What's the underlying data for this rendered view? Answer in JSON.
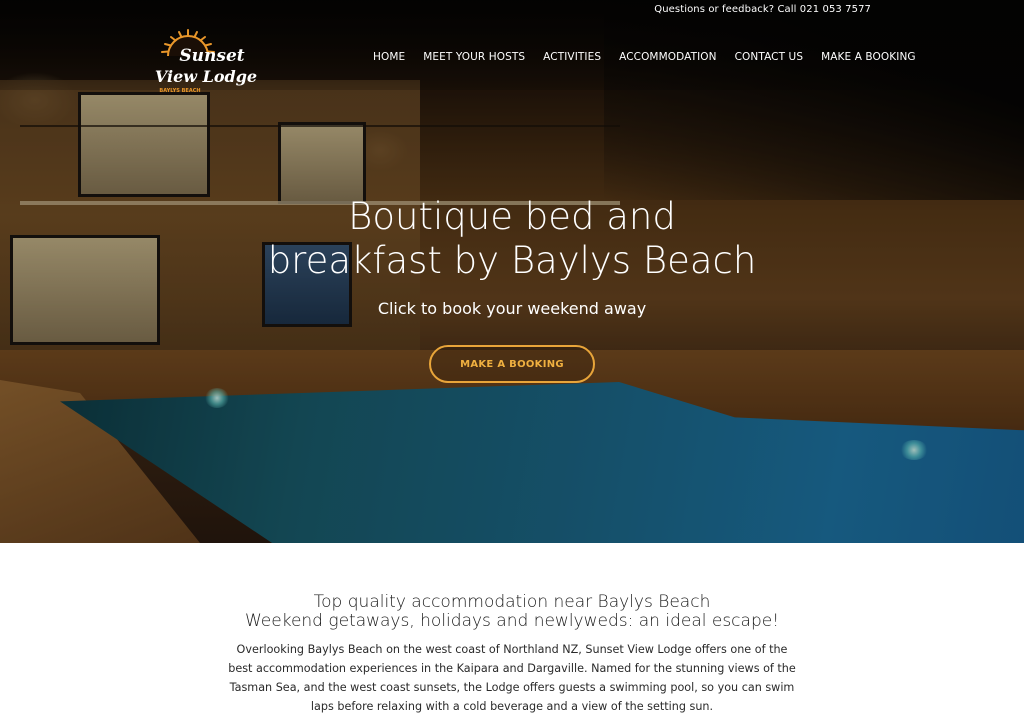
{
  "topbar": {
    "contact_text": "Questions or feedback? Call 021 053 7577"
  },
  "logo": {
    "line1": "Sunset",
    "line2": "View Lodge",
    "tagline": "BAYLYS BEACH",
    "icon": "sunburst-icon",
    "accent_color": "#e8962a"
  },
  "nav": {
    "items": [
      {
        "label": "HOME"
      },
      {
        "label": "MEET YOUR HOSTS"
      },
      {
        "label": "ACTIVITIES"
      },
      {
        "label": "ACCOMMODATION"
      },
      {
        "label": "CONTACT US"
      },
      {
        "label": "MAKE A BOOKING"
      }
    ]
  },
  "hero": {
    "title_line1": "Boutique bed and",
    "title_line2": "breakfast by Baylys Beach",
    "subtitle": "Click to book your weekend away",
    "cta_label": "MAKE A BOOKING",
    "cta_color": "#e8a53a"
  },
  "intro": {
    "heading_line1": "Top quality accommodation near Baylys Beach",
    "heading_line2": "Weekend getaways, holidays and newlyweds: an ideal escape!",
    "paragraph": "Overlooking Baylys Beach on the west coast of Northland NZ, Sunset View Lodge offers one of the best accommodation experiences in the Kaipara and Dargaville. Named for the stunning views of the Tasman Sea, and the west coast sunsets, the Lodge offers guests a swimming pool, so you can swim laps before relaxing with a cold beverage and a view of the setting sun."
  }
}
